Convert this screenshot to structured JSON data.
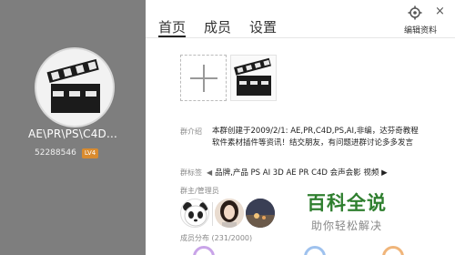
{
  "group": {
    "name": "AE\\PR\\PS\\C4D...",
    "id": "52288546",
    "level": "LV4"
  },
  "tabs": [
    {
      "label": "首页",
      "active": true
    },
    {
      "label": "成员",
      "active": false
    },
    {
      "label": "设置",
      "active": false
    }
  ],
  "header": {
    "edit_profile": "编辑资料",
    "close_glyph": "×"
  },
  "intro": {
    "label": "群介绍",
    "text": "本群创建于2009/2/1:  AE,PR,C4D,PS,AI,非编，达芬奇教程软件素材插件等资讯！结交朋友，有问题进群讨论多多发言"
  },
  "tags": {
    "label": "群标签",
    "prev": "◀",
    "values": "品牌,产品  PS  AI  3D  AE  PR  C4D  会声会影  视频 ▶"
  },
  "admins": {
    "label": "群主/管理员"
  },
  "members": {
    "label": "成员分布",
    "count": "(231/2000)"
  },
  "watermark": {
    "title": "百科全说",
    "subtitle": "助你轻松解决"
  },
  "colors": {
    "left_panel": "#7e7e7e",
    "level_badge": "#d98b2f",
    "watermark": "#2f7f2f"
  },
  "icons": [
    "clapperboard-icon",
    "plus-icon",
    "gear-icon",
    "close-icon",
    "prev-arrow-icon"
  ]
}
